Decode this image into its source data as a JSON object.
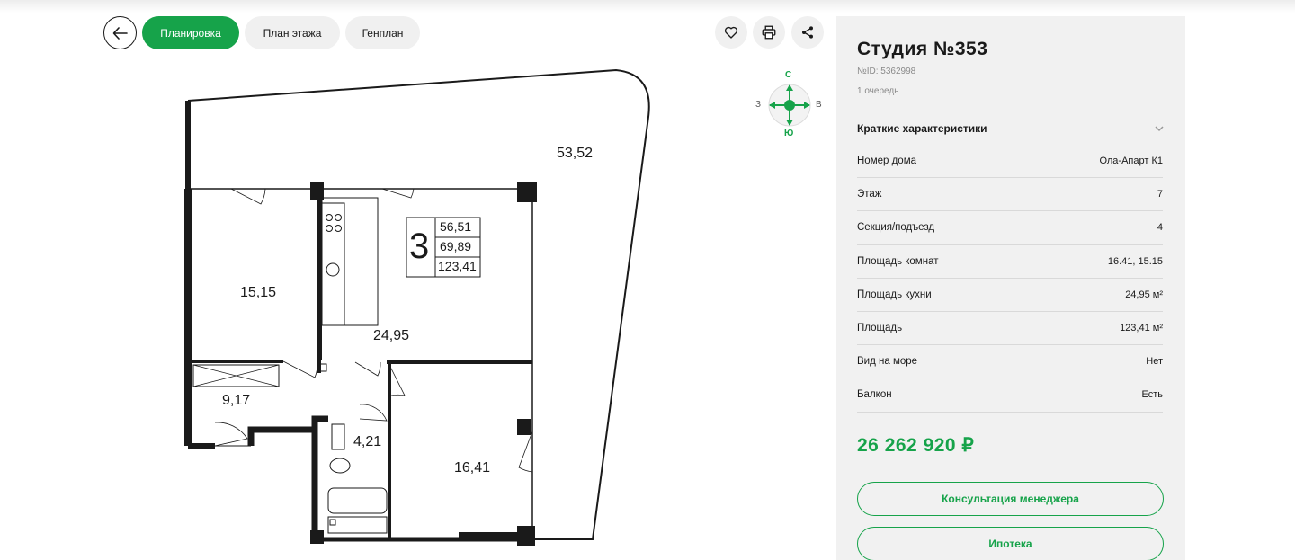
{
  "toolbar": {
    "tabs": [
      {
        "label": "Планировка",
        "active": true
      },
      {
        "label": "План этажа",
        "active": false
      },
      {
        "label": "Генплан",
        "active": false
      }
    ],
    "icons": [
      "back-arrow-icon",
      "heart-icon",
      "printer-icon",
      "share-icon"
    ]
  },
  "compass": {
    "north": "С",
    "south": "Ю",
    "west": "З",
    "east": "В"
  },
  "plan": {
    "rooms": {
      "terrace": "53,52",
      "bedroom1": "15,15",
      "living": "24,95",
      "hall": "9,17",
      "bath": "4,21",
      "bedroom2": "16,41"
    },
    "legend": {
      "rooms_count": "3",
      "living_area": "56,51",
      "total_area_no_terrace": "69,89",
      "total_area": "123,41"
    }
  },
  "listing": {
    "title": "Студия №353",
    "id": "№ID: 5362998",
    "queue": "1 очередь",
    "section_title": "Краткие характеристики",
    "specs": [
      {
        "label": "Номер дома",
        "value": "Ола-Апарт К1"
      },
      {
        "label": "Этаж",
        "value": "7"
      },
      {
        "label": "Секция/подъезд",
        "value": "4"
      },
      {
        "label": "Площадь комнат",
        "value": "16.41, 15.15"
      },
      {
        "label": "Площадь кухни",
        "value": "24,95 м²"
      },
      {
        "label": "Площадь",
        "value": "123,41 м²"
      },
      {
        "label": "Вид на море",
        "value": "Нет"
      },
      {
        "label": "Балкон",
        "value": "Есть"
      }
    ],
    "price": "26 262 920 ₽",
    "buttons": {
      "consult": "Консультация менеджера",
      "mortgage": "Ипотека"
    }
  },
  "colors": {
    "accent": "#16a34a",
    "panel": "#f1f1f1",
    "pill": "#f0f0f0"
  }
}
